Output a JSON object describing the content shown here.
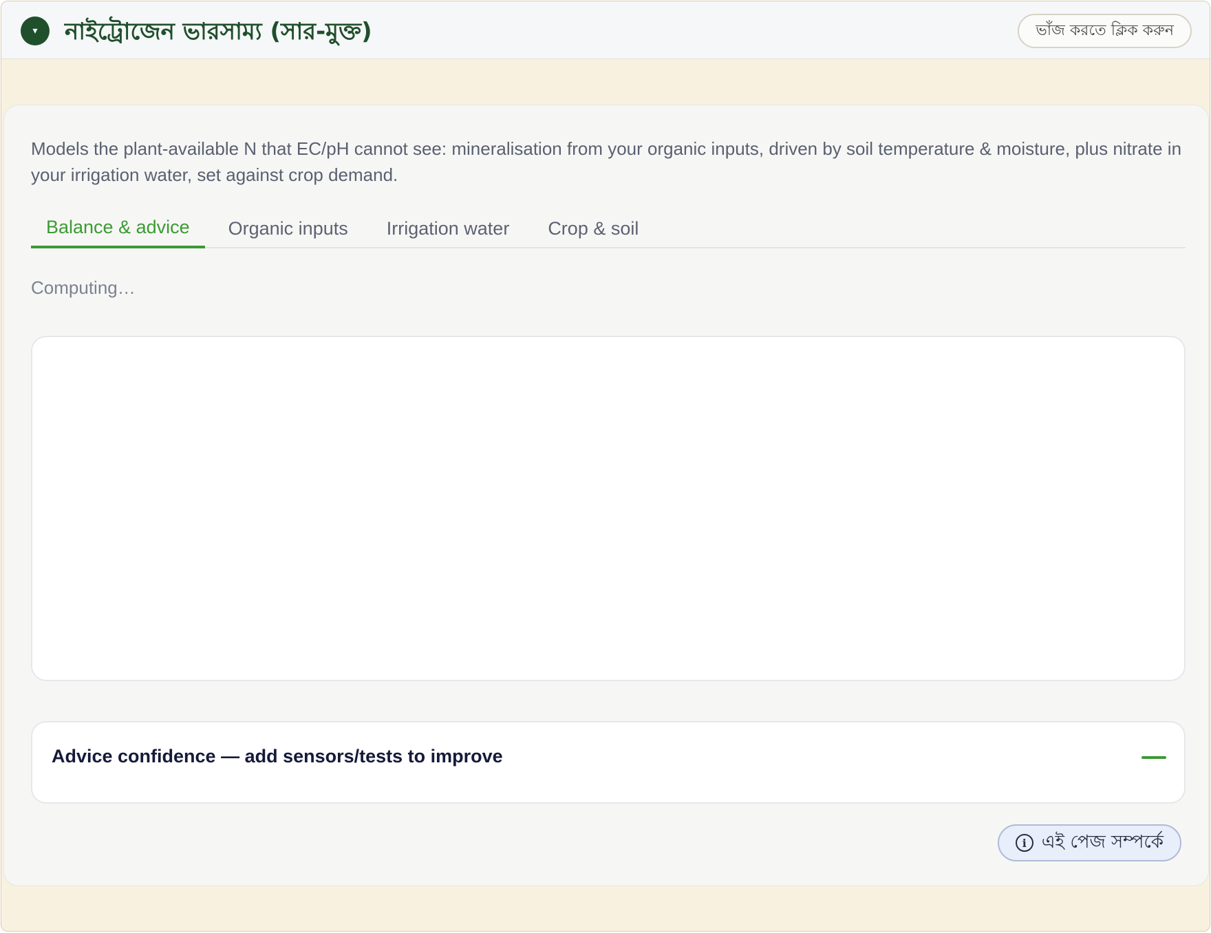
{
  "header": {
    "title": "নাইট্রোজেন ভারসাম্য (সার-মুক্ত)",
    "toggle_glyph": "▾",
    "collapse_label": "ভাঁজ করতে ক্লিক করুন"
  },
  "panel": {
    "description": "Models the plant-available N that EC/pH cannot see: mineralisation from your organic inputs, driven by soil temperature & moisture, plus nitrate in your irrigation water, set against crop demand.",
    "tabs": [
      {
        "label": "Balance & advice",
        "active": true
      },
      {
        "label": "Organic inputs",
        "active": false
      },
      {
        "label": "Irrigation water",
        "active": false
      },
      {
        "label": "Crop & soil",
        "active": false
      }
    ],
    "status": "Computing…",
    "confidence": {
      "title": "Advice confidence — add sensors/tests to improve"
    },
    "about": {
      "icon": "info-icon",
      "label": "এই পেজ সম্পর্কে"
    }
  },
  "colors": {
    "brand_dark_green": "#1f4f2b",
    "accent_green": "#3c9a33",
    "frame_bg": "#f9f1df"
  }
}
